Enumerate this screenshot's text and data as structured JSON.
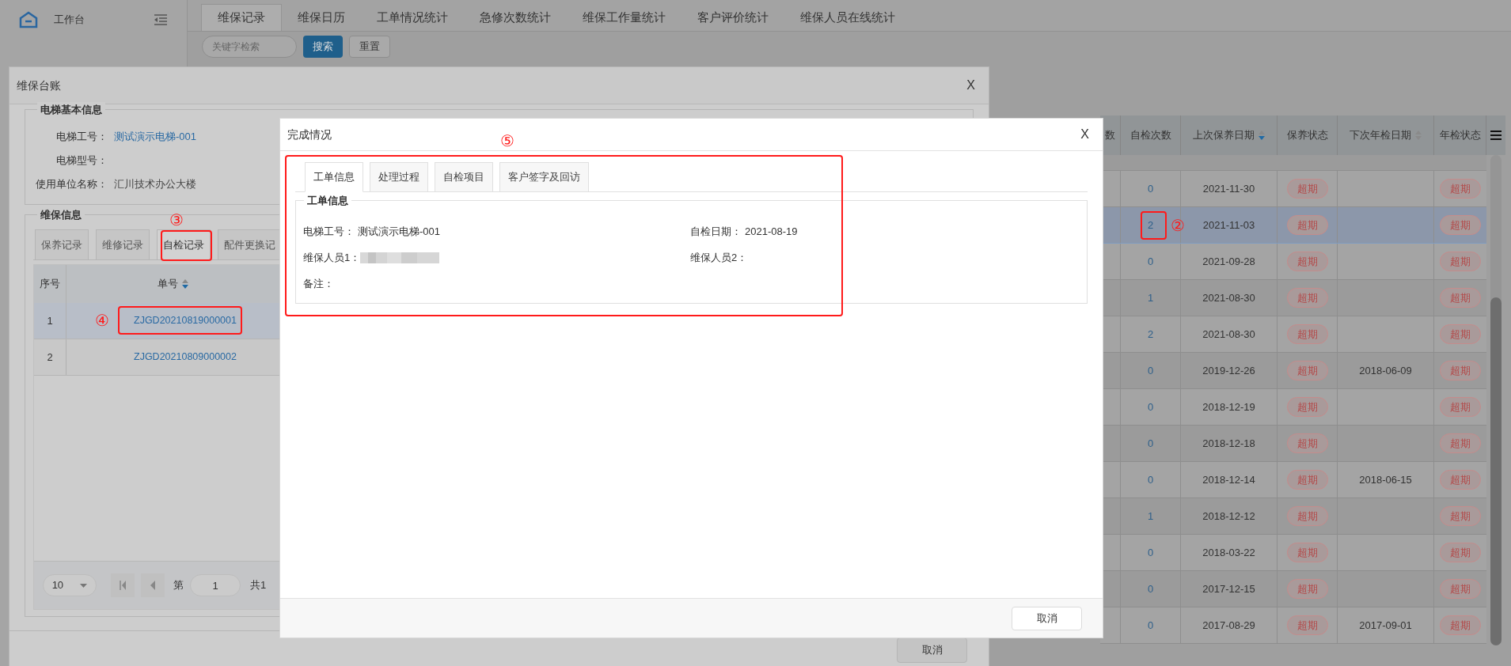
{
  "sidebar": {
    "title": "工作台"
  },
  "top_tabs": [
    {
      "label": "维保记录",
      "selected": true
    },
    {
      "label": "维保日历",
      "selected": false
    },
    {
      "label": "工单情况统计",
      "selected": false
    },
    {
      "label": "急修次数统计",
      "selected": false
    },
    {
      "label": "维保工作量统计",
      "selected": false
    },
    {
      "label": "客户评价统计",
      "selected": false
    },
    {
      "label": "维保人员在线统计",
      "selected": false
    }
  ],
  "search": {
    "placeholder": "关键字检索",
    "search_button": "搜索",
    "reset_button": "重置"
  },
  "records_table": {
    "columns": [
      {
        "label": "数"
      },
      {
        "label": "自检次数"
      },
      {
        "label": "上次保养日期",
        "sorted": true
      },
      {
        "label": "保养状态"
      },
      {
        "label": "下次年检日期",
        "sorted": false
      },
      {
        "label": "年检状态"
      }
    ],
    "rows": [
      {
        "count": "0",
        "last_date": "2021-11-30",
        "maint_status": "超期",
        "annual_status": "超期",
        "selected": false
      },
      {
        "count": "2",
        "last_date": "2021-11-03",
        "maint_status": "超期",
        "annual_status": "超期",
        "selected": true
      },
      {
        "count": "0",
        "last_date": "2021-09-28",
        "maint_status": "超期",
        "annual_status": "超期",
        "selected": false
      },
      {
        "count": "1",
        "last_date": "2021-08-30",
        "maint_status": "超期",
        "annual_status": "超期",
        "selected": false
      },
      {
        "count": "2",
        "last_date": "2021-08-30",
        "maint_status": "超期",
        "annual_status": "超期",
        "selected": false
      },
      {
        "count": "0",
        "last_date": "2019-12-26",
        "maint_status": "超期",
        "next_date": "2018-06-09",
        "annual_status": "超期",
        "selected": false
      },
      {
        "count": "0",
        "last_date": "2018-12-19",
        "maint_status": "超期",
        "annual_status": "超期",
        "selected": false
      },
      {
        "count": "0",
        "last_date": "2018-12-18",
        "maint_status": "超期",
        "annual_status": "超期",
        "selected": false
      },
      {
        "count": "0",
        "last_date": "2018-12-14",
        "maint_status": "超期",
        "next_date": "2018-06-15",
        "annual_status": "超期",
        "selected": false
      },
      {
        "count": "1",
        "last_date": "2018-12-12",
        "maint_status": "超期",
        "annual_status": "超期",
        "selected": false
      },
      {
        "count": "0",
        "last_date": "2018-03-22",
        "maint_status": "超期",
        "annual_status": "超期",
        "selected": false
      },
      {
        "count": "0",
        "last_date": "2017-12-15",
        "maint_status": "超期",
        "annual_status": "超期",
        "selected": false
      },
      {
        "count": "0",
        "last_date": "2017-08-29",
        "maint_status": "超期",
        "next_date": "2017-09-01",
        "annual_status": "超期",
        "selected": false
      }
    ]
  },
  "ledger_dialog": {
    "title": "维保台账",
    "close": "X",
    "basic_info": {
      "legend": "电梯基本信息",
      "fields": [
        {
          "label": "电梯工号：",
          "value": "测试演示电梯-001",
          "kind": "link"
        },
        {
          "label": "电梯型号："
        },
        {
          "label": "使用单位名称：",
          "value": "汇川技术办公大楼",
          "kind": "text"
        }
      ]
    },
    "maintenance_info": {
      "legend": "维保信息",
      "tabs": [
        {
          "label": "保养记录",
          "selected": false
        },
        {
          "label": "维修记录",
          "selected": false
        },
        {
          "label": "自检记录",
          "selected": true
        },
        {
          "label": "配件更换记",
          "selected": false
        }
      ],
      "table": {
        "columns": [
          {
            "label": "序号"
          },
          {
            "label": "单号",
            "sorted": true
          }
        ],
        "rows": [
          {
            "index": "1",
            "number": "ZJGD20210819000001",
            "selected": true
          },
          {
            "index": "2",
            "number": "ZJGD20210809000002",
            "selected": false
          }
        ]
      },
      "pagination": {
        "page_size": "10",
        "page_label": "第",
        "page": "1",
        "total": "共1"
      }
    },
    "cancel_button": "取消"
  },
  "completion_dialog": {
    "title": "完成情况",
    "close": "X",
    "tabs": [
      {
        "label": "工单信息",
        "selected": true
      },
      {
        "label": "处理过程",
        "selected": false
      },
      {
        "label": "自检项目",
        "selected": false
      },
      {
        "label": "客户签字及回访",
        "selected": false
      }
    ],
    "legend": "工单信息",
    "fields": [
      {
        "label": "电梯工号：",
        "value": "测试演示电梯-001"
      },
      {
        "label": "自检日期：",
        "value": "2021-08-19"
      },
      {
        "label": "维保人员1：",
        "redacted": true
      },
      {
        "label": "维保人员2："
      },
      {
        "label": "备注："
      }
    ],
    "cancel_button": "取消"
  },
  "annotations": {
    "count_mark": "②",
    "tab_mark": "③",
    "order_mark": "④",
    "panel_mark": "⑤"
  }
}
